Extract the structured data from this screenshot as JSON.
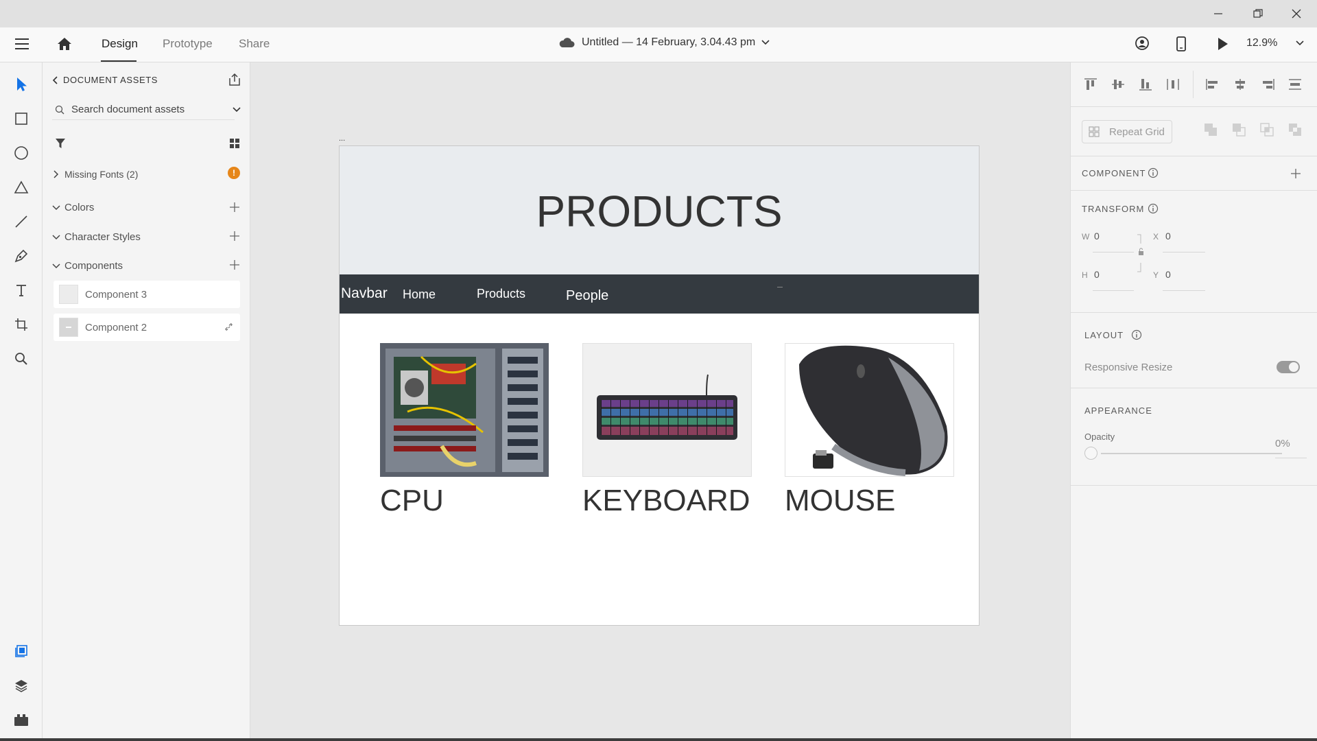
{
  "app": {
    "document_title": "Untitled — 14 February, 3.04.43 pm",
    "zoom": "12.9%"
  },
  "tabs": [
    "Design",
    "Prototype",
    "Share"
  ],
  "assets_panel": {
    "header": "DOCUMENT ASSETS",
    "search_placeholder": "Search document assets",
    "missing_fonts": "Missing Fonts (2)",
    "colors": "Colors",
    "character_styles": "Character Styles",
    "components": "Components",
    "component_items": [
      "Component 3",
      "Component 2"
    ]
  },
  "artboard": {
    "heading": "PRODUCTS",
    "navbar": {
      "brand": "Navbar",
      "links": [
        "Home",
        "Products",
        "People"
      ],
      "background": "#343a40"
    },
    "products": [
      {
        "label": "CPU"
      },
      {
        "label": "KEYBOARD"
      },
      {
        "label": "MOUSE"
      }
    ]
  },
  "properties": {
    "repeat_grid": "Repeat Grid",
    "component_title": "COMPONENT",
    "transform_title": "TRANSFORM",
    "w_label": "W",
    "w_value": "0",
    "h_label": "H",
    "h_value": "0",
    "x_label": "X",
    "x_value": "0",
    "y_label": "Y",
    "y_value": "0",
    "layout_title": "LAYOUT",
    "responsive_resize": "Responsive Resize",
    "appearance_title": "APPEARANCE",
    "opacity_label": "Opacity",
    "opacity_value": "0%"
  },
  "colors": {
    "accent_blue": "#1473e6",
    "warning_orange": "#e68619",
    "navbar_dark": "#343a40"
  }
}
